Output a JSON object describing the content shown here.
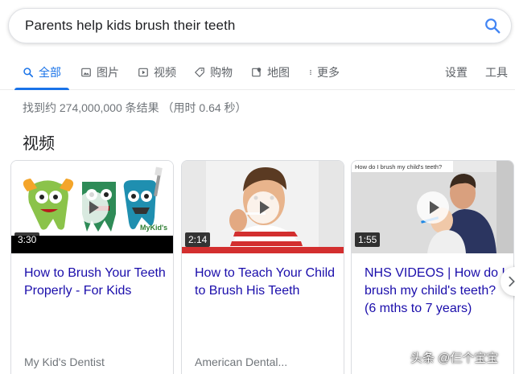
{
  "search": {
    "query": "Parents help kids brush their teeth"
  },
  "tabs": [
    {
      "label": "全部",
      "icon": "search-icon"
    },
    {
      "label": "图片",
      "icon": "image-icon"
    },
    {
      "label": "视频",
      "icon": "play-icon"
    },
    {
      "label": "购物",
      "icon": "tag-icon"
    },
    {
      "label": "地图",
      "icon": "map-icon"
    },
    {
      "label": "更多",
      "icon": "more-vert-icon"
    },
    {
      "label": "设置"
    },
    {
      "label": "工具"
    }
  ],
  "result_stats": "找到约 274,000,000 条结果 （用时 0.64 秒）",
  "section_title": "视频",
  "videos": [
    {
      "duration": "3:30",
      "title": "How to Brush Your Teeth Properly - For Kids",
      "source": "My Kid's Dentist",
      "logo_text": "MyKid's"
    },
    {
      "duration": "2:14",
      "title": "How to Teach Your Child to Brush His Teeth",
      "source": "American Dental..."
    },
    {
      "duration": "1:55",
      "title": "NHS VIDEOS | How do I brush my child's teeth? (6 mths to 7 years)",
      "source": "",
      "thumb_caption": "How do I brush my child's teeth?"
    }
  ],
  "watermark": "头条 @仨个宝宝",
  "colors": {
    "accent": "#1a73e8",
    "link": "#1a0dab",
    "muted": "#70757a"
  }
}
